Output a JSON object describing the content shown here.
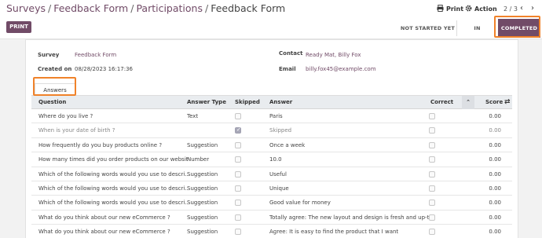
{
  "breadcrumb": {
    "items": [
      "Surveys",
      "Feedback Form",
      "Participations"
    ],
    "separator": "/",
    "current": "Feedback Form"
  },
  "top_actions": {
    "print_label": "Print",
    "action_label": "Action",
    "pager": "2 / 3"
  },
  "control": {
    "print_button": "PRINT",
    "statuses": [
      "NOT STARTED YET",
      "IN PROGRESS",
      "COMPLETED"
    ],
    "active_status": "COMPLETED"
  },
  "form": {
    "survey_label": "Survey",
    "survey_value": "Feedback Form",
    "created_label": "Created on",
    "created_value": "08/28/2023 16:17:36",
    "contact_label": "Contact",
    "contact_value": "Ready Mat, Billy Fox",
    "email_label": "Email",
    "email_value": "billy.fox45@example.com"
  },
  "tabs": {
    "answers": "Answers"
  },
  "table": {
    "headers": {
      "question": "Question",
      "answer_type": "Answer Type",
      "skipped": "Skipped",
      "answer": "Answer",
      "correct": "Correct",
      "score": "Score"
    },
    "rows": [
      {
        "question": "Where do you live ?",
        "type": "Text",
        "skipped": false,
        "answer": "Paris",
        "correct": false,
        "score": "0.00"
      },
      {
        "question": "When is your date of birth ?",
        "type": "",
        "skipped": true,
        "answer": "Skipped",
        "correct": false,
        "score": "0.00"
      },
      {
        "question": "How frequently do you buy products online ?",
        "type": "Suggestion",
        "skipped": false,
        "answer": "Once a week",
        "correct": false,
        "score": "0.00"
      },
      {
        "question": "How many times did you order products on our website ?",
        "type": "Number",
        "skipped": false,
        "answer": "10.0",
        "correct": false,
        "score": "0.00"
      },
      {
        "question": "Which of the following words would you use to descri...",
        "type": "Suggestion",
        "skipped": false,
        "answer": "Useful",
        "correct": false,
        "score": "0.00"
      },
      {
        "question": "Which of the following words would you use to descri...",
        "type": "Suggestion",
        "skipped": false,
        "answer": "Unique",
        "correct": false,
        "score": "0.00"
      },
      {
        "question": "Which of the following words would you use to descri...",
        "type": "Suggestion",
        "skipped": false,
        "answer": "Good value for money",
        "correct": false,
        "score": "0.00"
      },
      {
        "question": "What do you think about our new eCommerce ?",
        "type": "Suggestion",
        "skipped": false,
        "answer": "Totally agree: The new layout and design is fresh and up-to-...",
        "correct": false,
        "score": "0.00"
      },
      {
        "question": "What do you think about our new eCommerce ?",
        "type": "Suggestion",
        "skipped": false,
        "answer": "Agree: It is easy to find the product that I want",
        "correct": false,
        "score": "0.00"
      }
    ]
  },
  "colors": {
    "brand": "#714B67",
    "highlight": "#f0822a"
  },
  "icons": {
    "print": "print-icon",
    "action": "gear-icon",
    "prev": "chevron-left-icon",
    "next": "chevron-right-icon",
    "sort": "sort-icon",
    "optional_columns": "columns-toggle-icon"
  }
}
